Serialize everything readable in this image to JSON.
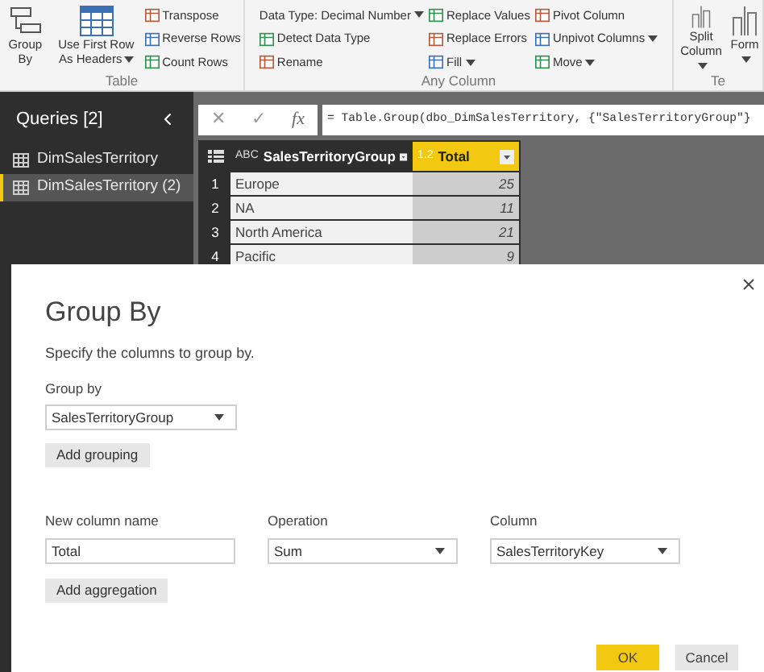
{
  "ribbon": {
    "groups": [
      {
        "label": "Table",
        "columns": [
          {
            "kind": "large",
            "items": [
              {
                "label": "Group By",
                "dropdown": false
              }
            ]
          },
          {
            "kind": "large",
            "items": [
              {
                "label": "Use First Row As Headers",
                "dropdown": true
              }
            ]
          },
          {
            "kind": "small",
            "items": [
              {
                "label": "Transpose",
                "dropdown": false
              },
              {
                "label": "Reverse Rows",
                "dropdown": false
              },
              {
                "label": "Count Rows",
                "dropdown": false
              }
            ]
          }
        ]
      },
      {
        "label": "Any Column",
        "columns": [
          {
            "kind": "small",
            "items": [
              {
                "label": "Data Type: Decimal Number",
                "dropdown": true
              },
              {
                "label": "Detect Data Type",
                "dropdown": false
              },
              {
                "label": "Rename",
                "dropdown": false
              }
            ]
          },
          {
            "kind": "small",
            "items": [
              {
                "label": "Replace Values",
                "dropdown": false
              },
              {
                "label": "Replace Errors",
                "dropdown": false
              },
              {
                "label": "Fill",
                "dropdown": true
              }
            ]
          },
          {
            "kind": "small",
            "items": [
              {
                "label": "Pivot Column",
                "dropdown": false
              },
              {
                "label": "Unpivot Columns",
                "dropdown": true
              },
              {
                "label": "Move",
                "dropdown": true
              }
            ]
          }
        ]
      },
      {
        "label": "Te",
        "columns": [
          {
            "kind": "large",
            "items": [
              {
                "label": "Split Column",
                "dropdown": true
              }
            ]
          },
          {
            "kind": "large",
            "items": [
              {
                "label": "Form",
                "dropdown": true
              }
            ]
          }
        ]
      }
    ]
  },
  "queries": {
    "title": "Queries [2]",
    "items": [
      {
        "name": "DimSalesTerritory",
        "selected": false
      },
      {
        "name": "DimSalesTerritory (2)",
        "selected": true
      }
    ]
  },
  "formula_bar": {
    "buttons": [
      "✕",
      "✓",
      "fx"
    ],
    "formula": "= Table.Group(dbo_DimSalesTerritory, {\"SalesTerritoryGroup\"}"
  },
  "table": {
    "columns": [
      {
        "name": "SalesTerritoryGroup",
        "type": "ABC",
        "selected": false
      },
      {
        "name": "Total",
        "type": "1.2",
        "selected": true
      }
    ],
    "rows": [
      {
        "index": "1",
        "cells": [
          "Europe",
          "25"
        ]
      },
      {
        "index": "2",
        "cells": [
          "NA",
          "11"
        ]
      },
      {
        "index": "3",
        "cells": [
          "North America",
          "21"
        ]
      },
      {
        "index": "4",
        "cells": [
          "Pacific",
          "9"
        ]
      }
    ]
  },
  "dialog": {
    "title": "Group By",
    "description": "Specify the columns to group by.",
    "group_by": {
      "label": "Group by",
      "value": "SalesTerritoryGroup"
    },
    "add_grouping": "Add grouping",
    "aggregation": [
      {
        "label": "New column name",
        "value": "Total",
        "kind": "text"
      },
      {
        "label": "Operation",
        "value": "Sum",
        "kind": "select"
      },
      {
        "label": "Column",
        "value": "SalesTerritoryKey",
        "kind": "select"
      }
    ],
    "add_aggregation": "Add aggregation",
    "buttons": [
      {
        "label": "OK",
        "primary": true
      },
      {
        "label": "Cancel",
        "primary": false
      }
    ]
  }
}
